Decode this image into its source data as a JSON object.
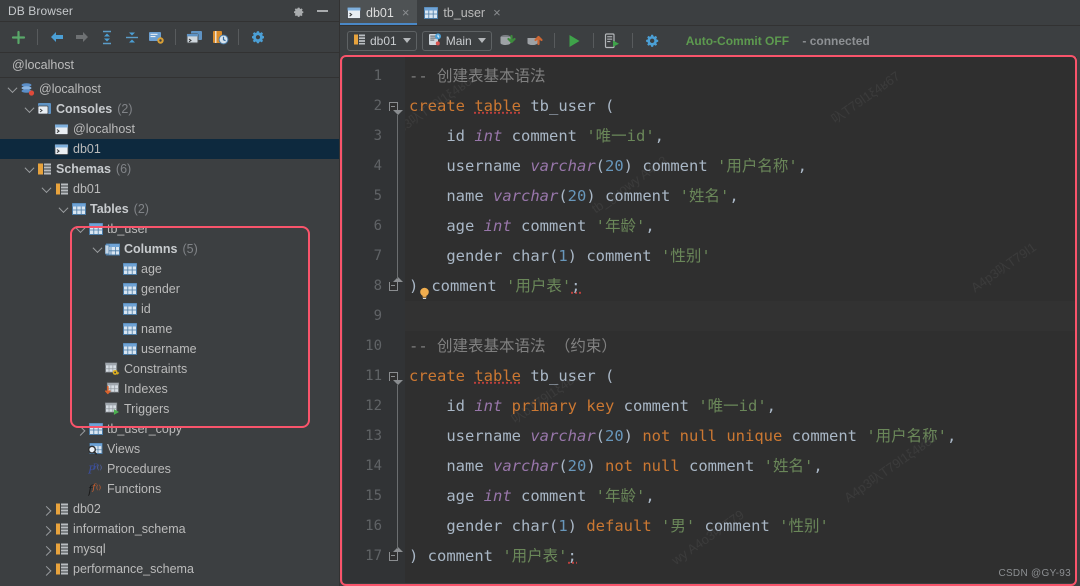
{
  "window": {
    "title": "DB Browser",
    "gear_icon": "gear-icon",
    "minimize_icon": "minimize-icon"
  },
  "left_toolbar": {
    "buttons": [
      {
        "name": "add-icon",
        "glyph": "plus"
      },
      {
        "name": "back-arrow-icon",
        "glyph": "back"
      },
      {
        "name": "forward-arrow-icon",
        "glyph": "forward"
      },
      {
        "name": "expand-all-icon",
        "glyph": "expand"
      },
      {
        "name": "collapse-all-icon",
        "glyph": "collapse"
      },
      {
        "name": "properties-icon",
        "glyph": "props"
      },
      {
        "name": "new-console-icon",
        "glyph": "console"
      },
      {
        "name": "history-icon",
        "glyph": "history"
      },
      {
        "name": "settings-gear-icon",
        "glyph": "gear"
      }
    ]
  },
  "breadcrumb": {
    "path": "@localhost"
  },
  "tree": {
    "nodes": [
      {
        "label": "@localhost",
        "indent": 0,
        "twisty": "down",
        "icon": "database-icon",
        "bold": false,
        "count": "",
        "selected": false
      },
      {
        "label": "Consoles",
        "indent": 1,
        "twisty": "down",
        "icon": "console-folder-icon",
        "bold": true,
        "count": "(2)",
        "selected": false
      },
      {
        "label": "@localhost",
        "indent": 2,
        "twisty": "none",
        "icon": "console-icon",
        "bold": false,
        "count": "",
        "selected": false
      },
      {
        "label": "db01",
        "indent": 2,
        "twisty": "none",
        "icon": "console-icon",
        "bold": false,
        "count": "",
        "selected": true
      },
      {
        "label": "Schemas",
        "indent": 1,
        "twisty": "down",
        "icon": "schemas-icon",
        "bold": true,
        "count": "(6)",
        "selected": false
      },
      {
        "label": "db01",
        "indent": 2,
        "twisty": "down",
        "icon": "schema-icon",
        "bold": false,
        "count": "",
        "selected": false
      },
      {
        "label": "Tables",
        "indent": 3,
        "twisty": "down",
        "icon": "table-group-icon",
        "bold": true,
        "count": "(2)",
        "selected": false
      },
      {
        "label": "tb_user",
        "indent": 4,
        "twisty": "down",
        "icon": "table-icon",
        "bold": false,
        "count": "",
        "selected": false
      },
      {
        "label": "Columns",
        "indent": 5,
        "twisty": "down",
        "icon": "columns-icon",
        "bold": true,
        "count": "(5)",
        "selected": false
      },
      {
        "label": "age",
        "indent": 6,
        "twisty": "none",
        "icon": "column-icon",
        "bold": false,
        "count": "",
        "selected": false
      },
      {
        "label": "gender",
        "indent": 6,
        "twisty": "none",
        "icon": "column-icon",
        "bold": false,
        "count": "",
        "selected": false
      },
      {
        "label": "id",
        "indent": 6,
        "twisty": "none",
        "icon": "column-icon",
        "bold": false,
        "count": "",
        "selected": false
      },
      {
        "label": "name",
        "indent": 6,
        "twisty": "none",
        "icon": "column-icon",
        "bold": false,
        "count": "",
        "selected": false
      },
      {
        "label": "username",
        "indent": 6,
        "twisty": "none",
        "icon": "column-icon",
        "bold": false,
        "count": "",
        "selected": false
      },
      {
        "label": "Constraints",
        "indent": 5,
        "twisty": "none",
        "icon": "constraints-icon",
        "bold": false,
        "count": "",
        "selected": false
      },
      {
        "label": "Indexes",
        "indent": 5,
        "twisty": "none",
        "icon": "indexes-icon",
        "bold": false,
        "count": "",
        "selected": false
      },
      {
        "label": "Triggers",
        "indent": 5,
        "twisty": "none",
        "icon": "triggers-icon",
        "bold": false,
        "count": "",
        "selected": false
      },
      {
        "label": "tb_user_copy",
        "indent": 4,
        "twisty": "right",
        "icon": "table-icon",
        "bold": false,
        "count": "",
        "selected": false
      },
      {
        "label": "Views",
        "indent": 4,
        "twisty": "none",
        "icon": "views-icon",
        "bold": false,
        "count": "",
        "selected": false
      },
      {
        "label": "Procedures",
        "indent": 4,
        "twisty": "none",
        "icon": "procedures-icon",
        "bold": false,
        "count": "",
        "selected": false
      },
      {
        "label": "Functions",
        "indent": 4,
        "twisty": "none",
        "icon": "functions-icon",
        "bold": false,
        "count": "",
        "selected": false
      },
      {
        "label": "db02",
        "indent": 2,
        "twisty": "right",
        "icon": "schema-icon",
        "bold": false,
        "count": "",
        "selected": false
      },
      {
        "label": "information_schema",
        "indent": 2,
        "twisty": "right",
        "icon": "schema-icon",
        "bold": false,
        "count": "",
        "selected": false
      },
      {
        "label": "mysql",
        "indent": 2,
        "twisty": "right",
        "icon": "schema-icon",
        "bold": false,
        "count": "",
        "selected": false
      },
      {
        "label": "performance_schema",
        "indent": 2,
        "twisty": "right",
        "icon": "schema-icon",
        "bold": false,
        "count": "",
        "selected": false
      }
    ]
  },
  "tabs": [
    {
      "label": "db01",
      "icon": "console-icon",
      "active": true,
      "close": "×"
    },
    {
      "label": "tb_user",
      "icon": "table-icon",
      "active": false,
      "close": "×"
    }
  ],
  "editor_toolbar": {
    "schema_combo": {
      "label": "db01",
      "icon": "schema-icon"
    },
    "session_combo": {
      "label": "Main",
      "icon": "session-icon"
    },
    "buttons": [
      {
        "name": "commit-icon",
        "glyph": "commit"
      },
      {
        "name": "rollback-icon",
        "glyph": "rollback"
      },
      {
        "name": "execute-icon",
        "glyph": "play"
      },
      {
        "name": "execute-script-icon",
        "glyph": "play-script"
      },
      {
        "name": "settings-gear-icon",
        "glyph": "gear"
      }
    ],
    "status_primary": "Auto-Commit OFF",
    "status_secondary": "- connected",
    "status_primary_color": "#5d9a4f",
    "status_secondary_color": "#8e9194"
  },
  "editor": {
    "current_line": 9,
    "watermark": "CSDN @GY-93",
    "lines": [
      {
        "n": 1,
        "fold": "none",
        "tokens": [
          {
            "t": "-- 创建表基本语法",
            "c": "com"
          }
        ]
      },
      {
        "n": 2,
        "fold": "start",
        "tokens": [
          {
            "t": "create",
            "c": "kw"
          },
          {
            "t": " ",
            "c": "id"
          },
          {
            "t": "table",
            "c": "kw-sq"
          },
          {
            "t": " tb_user (",
            "c": "id"
          }
        ]
      },
      {
        "n": 3,
        "fold": "mid",
        "tokens": [
          {
            "t": "    id ",
            "c": "id"
          },
          {
            "t": "int",
            "c": "type"
          },
          {
            "t": " comment ",
            "c": "id"
          },
          {
            "t": "'唯一id'",
            "c": "str"
          },
          {
            "t": ",",
            "c": "id"
          }
        ]
      },
      {
        "n": 4,
        "fold": "mid",
        "tokens": [
          {
            "t": "    username ",
            "c": "id"
          },
          {
            "t": "varchar",
            "c": "type"
          },
          {
            "t": "(",
            "c": "id"
          },
          {
            "t": "20",
            "c": "num"
          },
          {
            "t": ") comment ",
            "c": "id"
          },
          {
            "t": "'用户名称'",
            "c": "str"
          },
          {
            "t": ",",
            "c": "id"
          }
        ]
      },
      {
        "n": 5,
        "fold": "mid",
        "tokens": [
          {
            "t": "    name ",
            "c": "id"
          },
          {
            "t": "varchar",
            "c": "type"
          },
          {
            "t": "(",
            "c": "id"
          },
          {
            "t": "20",
            "c": "num"
          },
          {
            "t": ") comment ",
            "c": "id"
          },
          {
            "t": "'姓名'",
            "c": "str"
          },
          {
            "t": ",",
            "c": "id"
          }
        ]
      },
      {
        "n": 6,
        "fold": "mid",
        "tokens": [
          {
            "t": "    age ",
            "c": "id"
          },
          {
            "t": "int",
            "c": "type"
          },
          {
            "t": " comment ",
            "c": "id"
          },
          {
            "t": "'年龄'",
            "c": "str"
          },
          {
            "t": ",",
            "c": "id"
          }
        ]
      },
      {
        "n": 7,
        "fold": "mid",
        "tokens": [
          {
            "t": "    gender char(",
            "c": "id"
          },
          {
            "t": "1",
            "c": "num"
          },
          {
            "t": ") comment ",
            "c": "id"
          },
          {
            "t": "'性别'",
            "c": "str"
          }
        ]
      },
      {
        "n": 8,
        "fold": "end",
        "tokens": [
          {
            "t": ")",
            "c": "id"
          },
          {
            "t": "BULB",
            "c": "bulb"
          },
          {
            "t": "comment ",
            "c": "id"
          },
          {
            "t": "'用户表'",
            "c": "str"
          },
          {
            "t": ";",
            "c": "id-sq"
          }
        ]
      },
      {
        "n": 9,
        "fold": "none",
        "tokens": []
      },
      {
        "n": 10,
        "fold": "none",
        "tokens": [
          {
            "t": "-- 创建表基本语法 （约束）",
            "c": "com"
          }
        ]
      },
      {
        "n": 11,
        "fold": "start",
        "tokens": [
          {
            "t": "create",
            "c": "kw"
          },
          {
            "t": " ",
            "c": "id"
          },
          {
            "t": "table",
            "c": "kw-sq"
          },
          {
            "t": " tb_user (",
            "c": "id"
          }
        ]
      },
      {
        "n": 12,
        "fold": "mid",
        "tokens": [
          {
            "t": "    id ",
            "c": "id"
          },
          {
            "t": "int",
            "c": "type"
          },
          {
            "t": " ",
            "c": "id"
          },
          {
            "t": "primary key",
            "c": "kw"
          },
          {
            "t": " comment ",
            "c": "id"
          },
          {
            "t": "'唯一id'",
            "c": "str"
          },
          {
            "t": ",",
            "c": "id"
          }
        ]
      },
      {
        "n": 13,
        "fold": "mid",
        "tokens": [
          {
            "t": "    username ",
            "c": "id"
          },
          {
            "t": "varchar",
            "c": "type"
          },
          {
            "t": "(",
            "c": "id"
          },
          {
            "t": "20",
            "c": "num"
          },
          {
            "t": ") ",
            "c": "id"
          },
          {
            "t": "not null unique",
            "c": "kw"
          },
          {
            "t": " comment ",
            "c": "id"
          },
          {
            "t": "'用户名称'",
            "c": "str"
          },
          {
            "t": ",",
            "c": "id"
          }
        ]
      },
      {
        "n": 14,
        "fold": "mid",
        "tokens": [
          {
            "t": "    name ",
            "c": "id"
          },
          {
            "t": "varchar",
            "c": "type"
          },
          {
            "t": "(",
            "c": "id"
          },
          {
            "t": "20",
            "c": "num"
          },
          {
            "t": ") ",
            "c": "id"
          },
          {
            "t": "not null",
            "c": "kw"
          },
          {
            "t": " comment ",
            "c": "id"
          },
          {
            "t": "'姓名'",
            "c": "str"
          },
          {
            "t": ",",
            "c": "id"
          }
        ]
      },
      {
        "n": 15,
        "fold": "mid",
        "tokens": [
          {
            "t": "    age ",
            "c": "id"
          },
          {
            "t": "int",
            "c": "type"
          },
          {
            "t": " comment ",
            "c": "id"
          },
          {
            "t": "'年龄'",
            "c": "str"
          },
          {
            "t": ",",
            "c": "id"
          }
        ]
      },
      {
        "n": 16,
        "fold": "mid",
        "tokens": [
          {
            "t": "    gender char(",
            "c": "id"
          },
          {
            "t": "1",
            "c": "num"
          },
          {
            "t": ") ",
            "c": "id"
          },
          {
            "t": "default",
            "c": "kw"
          },
          {
            "t": " ",
            "c": "id"
          },
          {
            "t": "'男'",
            "c": "str"
          },
          {
            "t": " comment ",
            "c": "id"
          },
          {
            "t": "'性别'",
            "c": "str"
          }
        ]
      },
      {
        "n": 17,
        "fold": "end",
        "tokens": [
          {
            "t": ") comment ",
            "c": "id"
          },
          {
            "t": "'用户表'",
            "c": "str"
          },
          {
            "t": ";",
            "c": "id-sq"
          }
        ]
      }
    ]
  },
  "colors": {
    "panel_bg": "#3c3f41",
    "editor_bg": "#2f2f2f",
    "gutter_bg": "#313335",
    "selection_bg": "#0d293e",
    "tab_active_bg": "#4e5254",
    "tab_underline": "#4a88c7",
    "highlight_box": "#f9546b",
    "keyword": "#cc7832",
    "type": "#9876aa",
    "string": "#6a8759",
    "number": "#6897bb",
    "comment": "#808080",
    "identifier": "#a9b7c6"
  }
}
